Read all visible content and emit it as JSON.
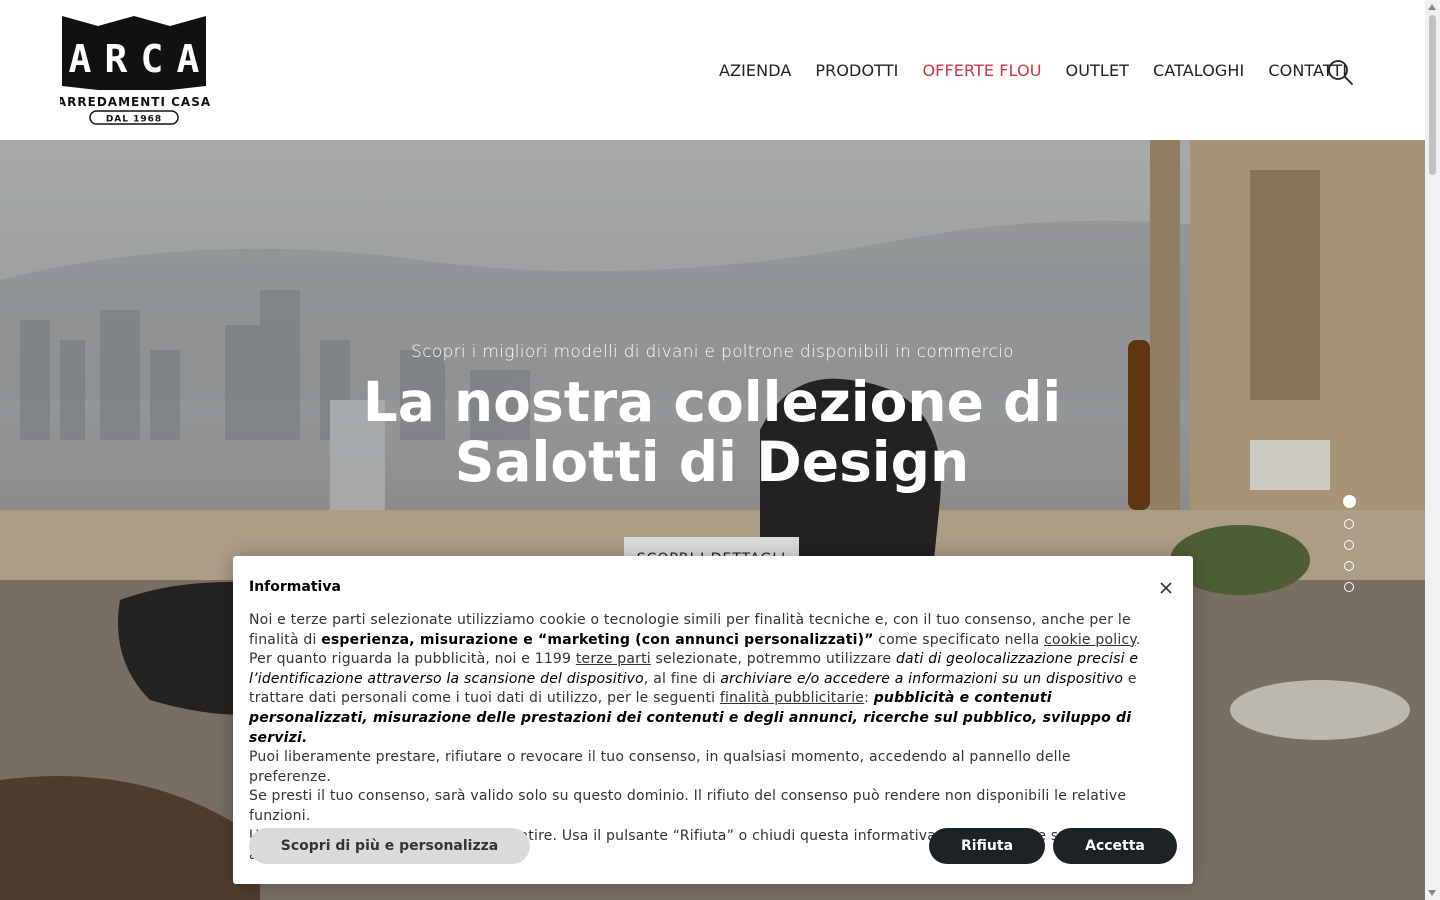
{
  "logo": {
    "letters": "ARCA",
    "line1": "ARREDAMENTI CASA",
    "line2": "DAL 1968"
  },
  "nav": {
    "items": [
      {
        "label": "AZIENDA"
      },
      {
        "label": "PRODOTTI"
      },
      {
        "label": "OFFERTE FLOU",
        "active": true
      },
      {
        "label": "OUTLET"
      },
      {
        "label": "CATALOGHI"
      },
      {
        "label": "CONTATTI"
      }
    ],
    "search_icon": "search-icon",
    "active_color": "#d9323a"
  },
  "hero": {
    "subtitle": "Scopri i migliori modelli di divani e poltrone disponibili in commercio",
    "title": "La nostra collezione di Salotti di Design",
    "button": "SCOPRI I DETTAGLI",
    "slide_count": 5,
    "active_slide": 1
  },
  "cookie": {
    "title": "Informativa",
    "close_icon": "close-icon",
    "p1_a": "Noi e terze parti selezionate utilizziamo cookie o tecnologie simili per finalità tecniche e, con il tuo consenso, anche per le finalità di ",
    "p1_b": "esperienza, misurazione e “marketing (con annunci personalizzati)”",
    "p1_c": " come specificato nella ",
    "p1_link": "cookie policy",
    "p1_d": ".",
    "p2_a": "Per quanto riguarda la pubblicità, noi e 1199 ",
    "p2_link1": "terze parti",
    "p2_b": " selezionate, potremmo utilizzare ",
    "p2_c": "dati di geolocalizzazione precisi e l’identificazione attraverso la scansione del dispositivo",
    "p2_d": ", al fine di ",
    "p2_e": "archiviare e/o accedere a informazioni su un dispositivo",
    "p2_f": " e trattare dati personali come i tuoi dati di utilizzo, per le seguenti ",
    "p2_link2": "finalità pubblicitarie",
    "p2_g": ": ",
    "p2_h": "pubblicità e contenuti personalizzati, misurazione delle prestazioni dei contenuti e degli annunci, ricerche sul pubblico, sviluppo di servizi.",
    "p3": "Puoi liberamente prestare, rifiutare o revocare il tuo consenso, in qualsiasi momento, accedendo al pannello delle preferenze.",
    "p4": "Se presti il tuo consenso, sarà valido solo su questo dominio. Il rifiuto del consenso può rendere non disponibili le relative funzioni.",
    "p5": "Usa il pulsante “Accetta” per acconsentire. Usa il pulsante “Rifiuta” o chiudi questa informativa per continuare senza accettare.",
    "btn_more": "Scopri di più e personalizza",
    "btn_reject": "Rifiuta",
    "btn_accept": "Accetta"
  }
}
